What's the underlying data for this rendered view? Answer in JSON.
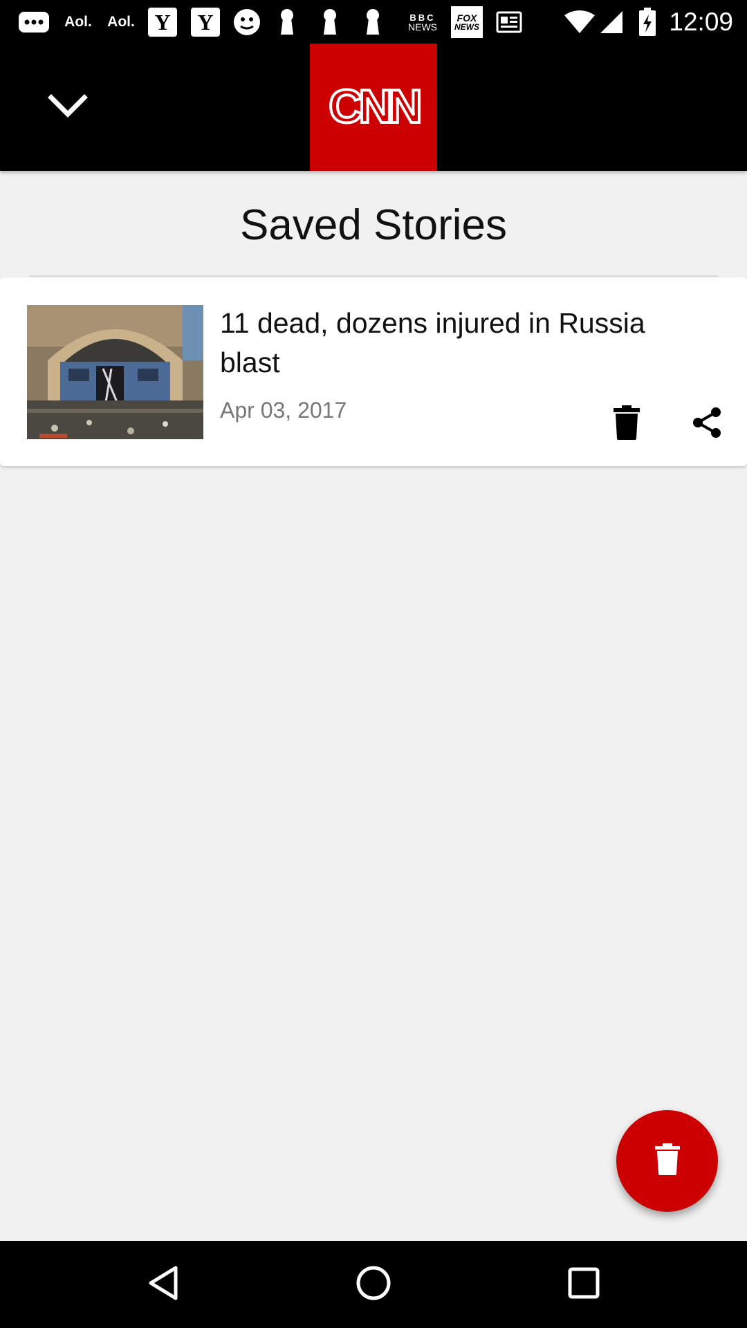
{
  "status_bar": {
    "time": "12:09",
    "notification_icons": [
      "messages-icon",
      "aol-icon",
      "aol-icon",
      "yahoo-icon",
      "yahoo-icon",
      "ghost-icon",
      "keyhole-icon",
      "keyhole-icon",
      "keyhole-icon",
      "bbc-news-icon",
      "fox-news-icon",
      "newspaper-icon"
    ],
    "aol_label": "Aol.",
    "yahoo_label": "Y",
    "bbc_label_top": "BBC",
    "bbc_label_bottom": "NEWS",
    "fox_label_top": "FOX",
    "fox_label_bottom": "NEWS",
    "system_icons": [
      "wifi-icon",
      "signal-icon",
      "battery-charging-icon"
    ]
  },
  "app_bar": {
    "logo_text": "CNN",
    "logo_color": "#cc0000",
    "left_icon": "chevron-down-icon"
  },
  "page": {
    "title": "Saved Stories"
  },
  "stories": [
    {
      "headline": "11 dead, dozens injured in Russia blast",
      "date": "Apr 03, 2017",
      "actions": [
        "trash-icon",
        "share-icon"
      ]
    }
  ],
  "fab": {
    "icon": "trash-icon",
    "color": "#cc0000"
  },
  "nav_bar": {
    "buttons": [
      "back-icon",
      "home-icon",
      "recents-icon"
    ]
  }
}
